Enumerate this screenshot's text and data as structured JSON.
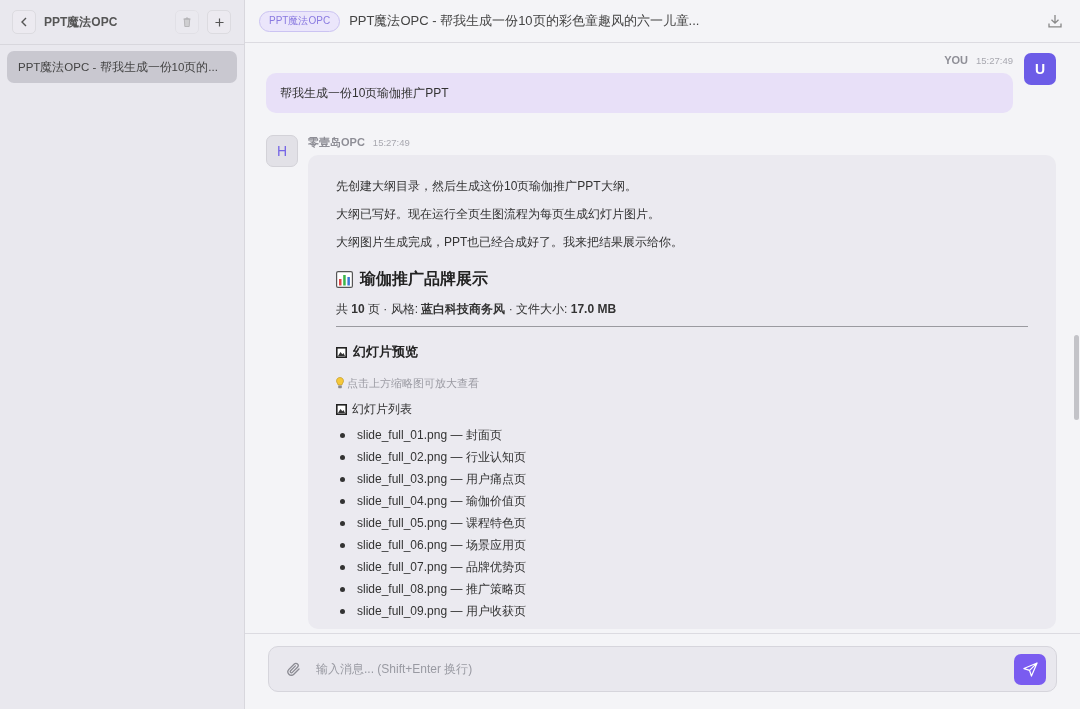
{
  "sidebar": {
    "title": "PPT魔法OPC",
    "delete_button": {
      "disabled": true
    },
    "items": [
      {
        "label": "PPT魔法OPC - 帮我生成一份10页的...",
        "selected": true
      }
    ]
  },
  "header": {
    "tag": "PPT魔法OPC",
    "title": "PPT魔法OPC - 帮我生成一份10页的彩色童趣风的六一儿童..."
  },
  "messages": [
    {
      "kind": "user",
      "sender": "YOU",
      "time": "15:27:49",
      "avatar": "U",
      "text": "帮我生成一份10页瑜伽推广PPT"
    },
    {
      "kind": "assistant",
      "sender": "零壹岛OPC",
      "time": "15:27:49",
      "avatar": "H",
      "blocks": [
        {
          "kind": "paragraph",
          "text": "先创建大纲目录，然后生成这份10页瑜伽推广PPT大纲。"
        },
        {
          "kind": "paragraph",
          "text": "大纲已写好。现在运行全页生图流程为每页生成幻灯片图片。"
        },
        {
          "kind": "paragraph",
          "text": "大纲图片生成完成，PPT也已经合成好了。我来把结果展示给你。"
        },
        {
          "kind": "title",
          "text": "瑜伽推广品牌展示"
        },
        {
          "kind": "summary",
          "text": "共 **10** 页 · 风格: **蓝白科技商务风** · 文件大小: **17.0 MB**"
        },
        {
          "kind": "rule"
        },
        {
          "kind": "subtitle",
          "text": "幻灯片预览"
        },
        {
          "kind": "tip",
          "text": "点击上方缩略图可放大查看"
        },
        {
          "kind": "label",
          "text": "幻灯片列表"
        },
        {
          "kind": "list",
          "items": [
            "slide_full_01.png — 封面页",
            "slide_full_02.png — 行业认知页",
            "slide_full_03.png — 用户痛点页",
            "slide_full_04.png — 瑜伽价值页",
            "slide_full_05.png — 课程特色页",
            "slide_full_06.png — 场景应用页",
            "slide_full_07.png — 品牌优势页",
            "slide_full_08.png — 推广策略页",
            "slide_full_09.png — 用户收获页"
          ]
        }
      ]
    }
  ],
  "composer": {
    "placeholder": "输入消息... (Shift+Enter 换行)"
  }
}
